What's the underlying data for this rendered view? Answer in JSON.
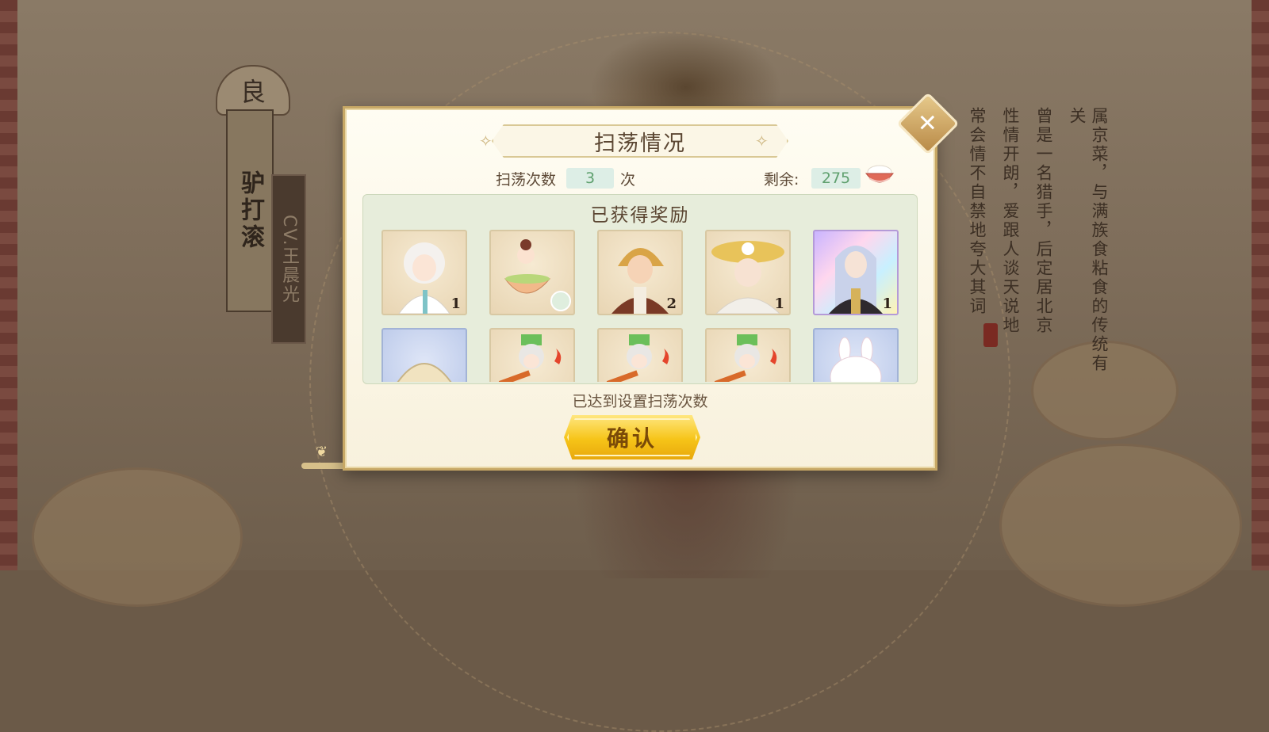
{
  "background": {
    "rank_char": "良",
    "character_name": "驴打滚",
    "cv_label": "CV.王晨光",
    "description_columns": [
      "属京菜，与满族食粘食的传统有关",
      "曾是一名猎手，后定居北京",
      "性情开朗，爱跟人谈天说地",
      "常会情不自禁地夸大其词"
    ]
  },
  "dialog": {
    "title": "扫荡情况",
    "sweep_count_label": "扫荡次数",
    "sweep_count_value": "3",
    "sweep_count_unit": "次",
    "remaining_label": "剩余:",
    "remaining_value": "275",
    "remaining_icon": "rice-bowl-icon",
    "rewards_title": "已获得奖励",
    "rewards": [
      {
        "name": "white-haired-character",
        "count": "1",
        "frame": "normal"
      },
      {
        "name": "tea-bowl-sprite",
        "count": "",
        "frame": "normal"
      },
      {
        "name": "blonde-warrior-character",
        "count": "2",
        "frame": "normal"
      },
      {
        "name": "straw-hat-character",
        "count": "1",
        "frame": "normal"
      },
      {
        "name": "silver-haired-character",
        "count": "1",
        "frame": "rare"
      },
      {
        "name": "dumpling-item",
        "count": "",
        "frame": "blue"
      },
      {
        "name": "chibi-chef-item",
        "count": "",
        "frame": "normal"
      },
      {
        "name": "chibi-chef-item",
        "count": "",
        "frame": "normal"
      },
      {
        "name": "chibi-chef-item",
        "count": "",
        "frame": "normal"
      },
      {
        "name": "bunny-bun-item",
        "count": "",
        "frame": "blue"
      }
    ],
    "status_text": "已达到设置扫荡次数",
    "confirm_label": "确认",
    "close_glyph": "✕"
  },
  "colors": {
    "accent_gold": "#f6c418",
    "value_green": "#5fa06e",
    "panel_green": "#e7eddb"
  }
}
